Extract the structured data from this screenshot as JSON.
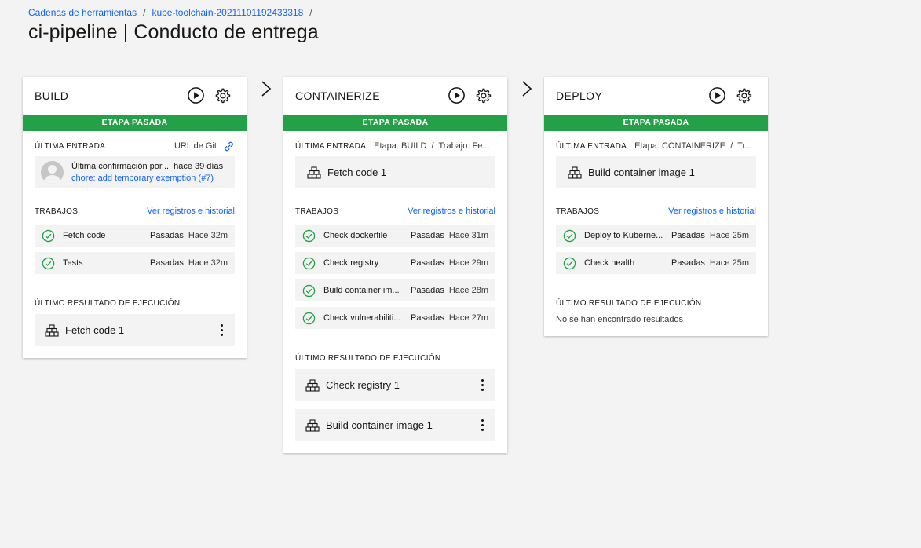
{
  "breadcrumb": [
    {
      "label": "Cadenas de herramientas"
    },
    {
      "label": "kube-toolchain-20211101192433318"
    }
  ],
  "breadcrumb_separator": "/",
  "page_title": "ci-pipeline | Conducto de entrega",
  "colors": {
    "success": "#24a148",
    "link": "#0f62fe"
  },
  "stages": [
    {
      "title": "BUILD",
      "status": "ETAPA PASADA",
      "input_label": "ÚLTIMA ENTRADA",
      "input_meta": "URL de Git",
      "commit": {
        "message": "Última confirmación por...",
        "time": "hace 39 días",
        "link": "chore: add temporary exemption (#7)"
      },
      "jobs_label": "TRABAJOS",
      "jobs_link": "Ver registros e historial",
      "jobs": [
        {
          "name": "Fetch code",
          "status": "Pasadas",
          "time": "Hace 32m"
        },
        {
          "name": "Tests",
          "status": "Pasadas",
          "time": "Hace 32m"
        }
      ],
      "result_label": "ÚLTIMO RESULTADO DE EJECUCIÓN",
      "results": [
        "Fetch code 1"
      ]
    },
    {
      "title": "CONTAINERIZE",
      "status": "ETAPA PASADA",
      "input_label": "ÚLTIMA ENTRADA",
      "input_meta": "Etapa: BUILD  /  Trabajo: Fe...",
      "input_value": "Fetch code 1",
      "jobs_label": "TRABAJOS",
      "jobs_link": "Ver registros e historial",
      "jobs": [
        {
          "name": "Check dockerfile",
          "status": "Pasadas",
          "time": "Hace 31m"
        },
        {
          "name": "Check registry",
          "status": "Pasadas",
          "time": "Hace 29m"
        },
        {
          "name": "Build container im...",
          "status": "Pasadas",
          "time": "Hace 28m"
        },
        {
          "name": "Check vulnerabiliti...",
          "status": "Pasadas",
          "time": "Hace 27m"
        }
      ],
      "result_label": "ÚLTIMO RESULTADO DE EJECUCIÓN",
      "results": [
        "Check registry 1",
        "Build container image 1"
      ]
    },
    {
      "title": "DEPLOY",
      "status": "ETAPA PASADA",
      "input_label": "ÚLTIMA ENTRADA",
      "input_meta": "Etapa: CONTAINERIZE  /  Tr...",
      "input_value": "Build container image 1",
      "jobs_label": "TRABAJOS",
      "jobs_link": "Ver registros e historial",
      "jobs": [
        {
          "name": "Deploy to Kuberne...",
          "status": "Pasadas",
          "time": "Hace 25m"
        },
        {
          "name": "Check health",
          "status": "Pasadas",
          "time": "Hace 25m"
        }
      ],
      "result_label": "ÚLTIMO RESULTADO DE EJECUCIÓN",
      "empty_result": "No se han encontrado resultados"
    }
  ]
}
